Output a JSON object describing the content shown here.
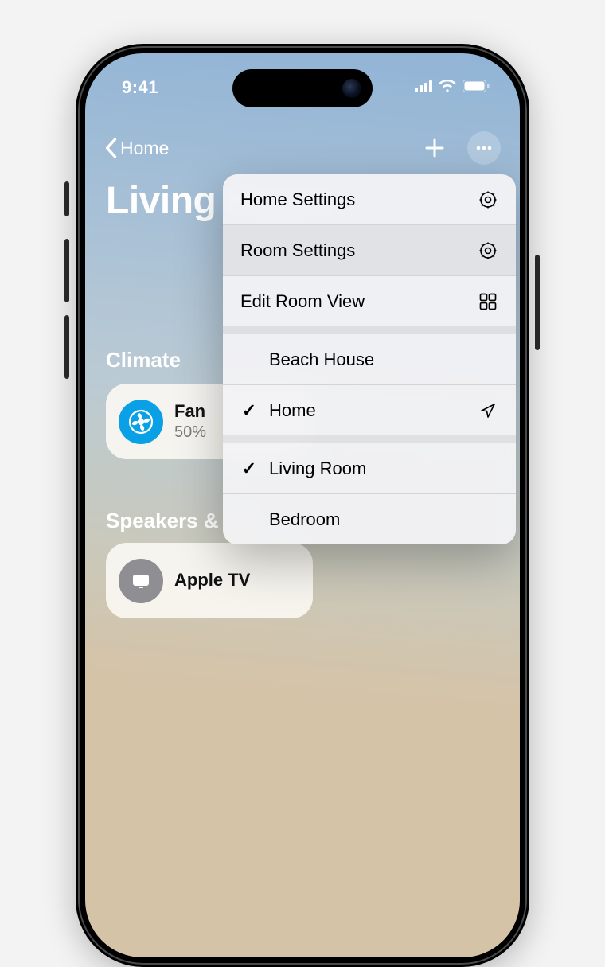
{
  "statusbar": {
    "time": "9:41"
  },
  "nav": {
    "back_label": "Home"
  },
  "title": "Living Room",
  "sections": {
    "climate": {
      "label": "Climate",
      "tile": {
        "name": "Fan",
        "status": "50%"
      }
    },
    "speakers": {
      "label": "Speakers & TV",
      "tile": {
        "name": "Apple TV"
      }
    }
  },
  "menu": {
    "settings": [
      {
        "label": "Home Settings"
      },
      {
        "label": "Room Settings"
      },
      {
        "label": "Edit Room View"
      }
    ],
    "homes": [
      {
        "label": "Beach House",
        "selected": false
      },
      {
        "label": "Home",
        "selected": true
      }
    ],
    "rooms": [
      {
        "label": "Living Room",
        "selected": true
      },
      {
        "label": "Bedroom",
        "selected": false
      }
    ]
  }
}
